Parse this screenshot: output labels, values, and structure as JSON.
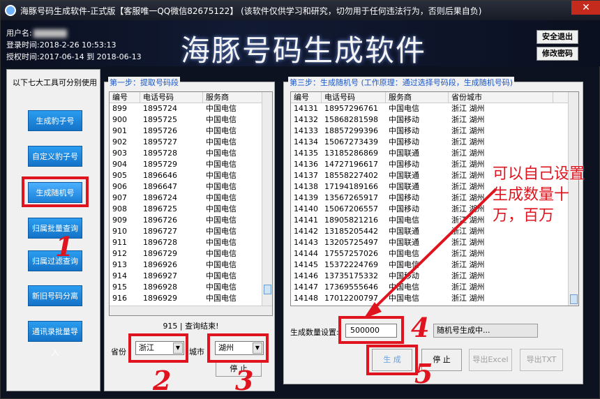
{
  "window": {
    "title": "海豚号码生成软件-正式版【客服唯一QQ微信82675122】 (该软件仅供学习和研究，切勿用于任何违法行为，否则后果自负)",
    "close_glyph": "✕"
  },
  "header": {
    "user_label": "用户名:",
    "login_label": "登录时间:",
    "login_time": "2018-2-26 10:53:13",
    "license_label": "授权时间:",
    "license_range": "2017-06-14 到 2018-06-13",
    "app_title": "海豚号码生成软件",
    "logout_button": "安全退出",
    "change_password_button": "修改密码"
  },
  "sidebar": {
    "title": "以下七大工具可分别使用",
    "tools": [
      {
        "label": "生成豹子号"
      },
      {
        "label": "自定义豹子号"
      },
      {
        "label": "生成随机号"
      },
      {
        "label": "归属批量查询"
      },
      {
        "label": "归属过滤查询"
      },
      {
        "label": "新旧号码分离"
      },
      {
        "label": "通讯录批量导入"
      }
    ]
  },
  "step1": {
    "title": "第一步：提取号码段",
    "columns": [
      "编号",
      "电话号码",
      "服务商"
    ],
    "rows": [
      [
        "899",
        "1895724",
        "中国电信"
      ],
      [
        "900",
        "1895725",
        "中国电信"
      ],
      [
        "901",
        "1895726",
        "中国电信"
      ],
      [
        "902",
        "1895727",
        "中国电信"
      ],
      [
        "903",
        "1895728",
        "中国电信"
      ],
      [
        "904",
        "1895729",
        "中国电信"
      ],
      [
        "905",
        "1896646",
        "中国电信"
      ],
      [
        "906",
        "1896647",
        "中国电信"
      ],
      [
        "907",
        "1896724",
        "中国电信"
      ],
      [
        "908",
        "1896725",
        "中国电信"
      ],
      [
        "909",
        "1896726",
        "中国电信"
      ],
      [
        "910",
        "1896727",
        "中国电信"
      ],
      [
        "911",
        "1896728",
        "中国电信"
      ],
      [
        "912",
        "1896729",
        "中国电信"
      ],
      [
        "913",
        "1896926",
        "中国电信"
      ],
      [
        "914",
        "1896927",
        "中国电信"
      ],
      [
        "915",
        "1896928",
        "中国电信"
      ],
      [
        "916",
        "1896929",
        "中国电信"
      ]
    ],
    "status": "915 | 查询结束!",
    "province_label": "省份",
    "province_value": "浙江",
    "city_label": "城市",
    "city_value": "湖州",
    "stop_button": "停 止"
  },
  "step3": {
    "title": "第三步：生成随机号 (工作原理：通过选择号码段，生成随机号码)",
    "columns": [
      "编号",
      "电话号码",
      "服务商",
      "省份城市"
    ],
    "rows": [
      [
        "14131",
        "18957296761",
        "中国电信",
        "浙江 湖州"
      ],
      [
        "14132",
        "15868281598",
        "中国移动",
        "浙江 湖州"
      ],
      [
        "14133",
        "18857299396",
        "中国移动",
        "浙江 湖州"
      ],
      [
        "14134",
        "15067273439",
        "中国移动",
        "浙江 湖州"
      ],
      [
        "14135",
        "13185286869",
        "中国联通",
        "浙江 湖州"
      ],
      [
        "14136",
        "14727196617",
        "中国移动",
        "浙江 湖州"
      ],
      [
        "14137",
        "18558227402",
        "中国联通",
        "浙江 湖州"
      ],
      [
        "14138",
        "17194189166",
        "中国联通",
        "浙江 湖州"
      ],
      [
        "14139",
        "13567265917",
        "中国移动",
        "浙江 湖州"
      ],
      [
        "14140",
        "15067206557",
        "中国移动",
        "浙江 湖州"
      ],
      [
        "14141",
        "18905821216",
        "中国电信",
        "浙江 湖州"
      ],
      [
        "14142",
        "13185205442",
        "中国联通",
        "浙江 湖州"
      ],
      [
        "14143",
        "13205725497",
        "中国联通",
        "浙江 湖州"
      ],
      [
        "14144",
        "17557257026",
        "中国电信",
        "浙江 湖州"
      ],
      [
        "14145",
        "15372224769",
        "中国电信",
        "浙江 湖州"
      ],
      [
        "14146",
        "13735175332",
        "中国移动",
        "浙江 湖州"
      ],
      [
        "14147",
        "17369555646",
        "中国电信",
        "浙江 湖州"
      ],
      [
        "14148",
        "17012200797",
        "中国电信",
        "浙江 湖州"
      ]
    ],
    "count_label": "生成数量设置:",
    "count_value": "500000",
    "progress_text": "随机号生成中...",
    "generate_button": "生 成",
    "stop_button": "停 止",
    "export_excel_button": "导出Excel",
    "export_txt_button": "导出TXT"
  },
  "annotations": {
    "note": "可以自己设置生成数量十万，百万",
    "marks": [
      "1",
      "2",
      "3",
      "4",
      "5"
    ]
  },
  "colors": {
    "annotation_red": "#e0141e",
    "tool_button_blue": "#1e88e5",
    "group_title_blue": "#1a56c8"
  }
}
